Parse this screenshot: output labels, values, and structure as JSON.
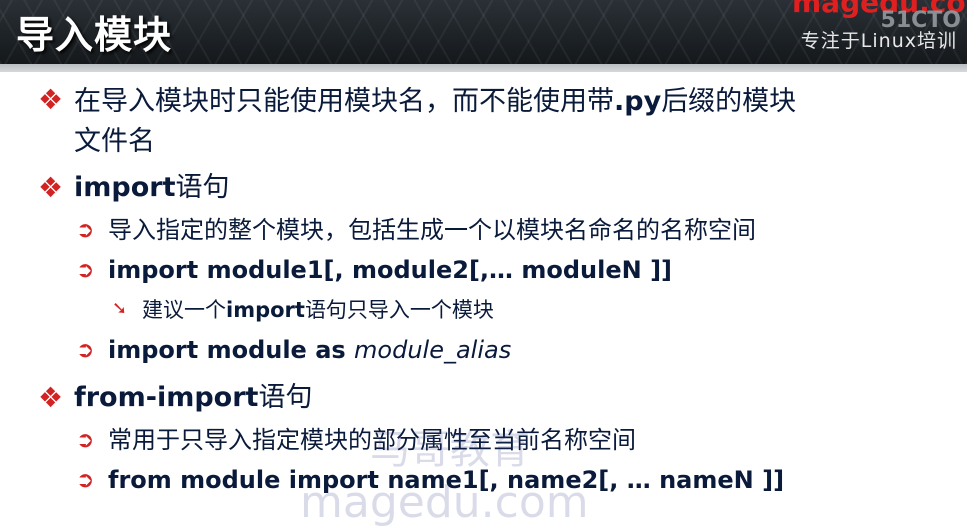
{
  "header": {
    "title": "导入模块",
    "brand": "magedu.com",
    "watermark": "51CTO",
    "slogan": "专注于Linux培训"
  },
  "items": {
    "i1": {
      "line1_a": "在导入模块时只能使用模块名，而不能使用带",
      "line1_code": ".py",
      "line1_b": "后缀的模块",
      "line2": "文件名"
    },
    "i2": {
      "code": "import",
      "rest": "语句",
      "sub1": "导入指定的整个模块，包括生成一个以模块名命名的名称空间",
      "sub2": "import module1[, module2[,… moduleN ]]",
      "sub2_note_a": "建议一个",
      "sub2_note_code": "import",
      "sub2_note_b": "语句只导入一个模块",
      "sub3_a": "import module as ",
      "sub3_b": "module_alias"
    },
    "i3": {
      "code": "from-import",
      "rest": "语句",
      "sub1": "常用于只导入指定模块的部分属性至当前名称空间",
      "sub2": "from module import name1[, name2[, … nameN ]]"
    }
  },
  "bullets": {
    "level1": "❖",
    "level2": "➲",
    "level3": "➘"
  },
  "watermarks": {
    "mid": "马哥教育",
    "bottom": "magedu.com"
  }
}
